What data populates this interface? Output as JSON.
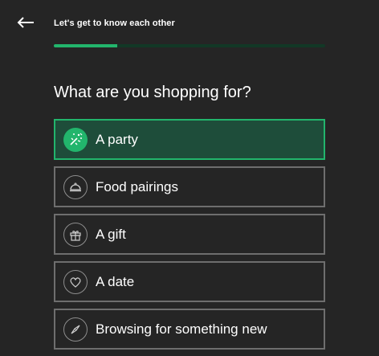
{
  "header": {
    "title": "Let's get to know each other",
    "progress_fraction": 0.235
  },
  "question": "What are you shopping for?",
  "options": [
    {
      "label": "A party",
      "icon": "party-popper-icon",
      "selected": true
    },
    {
      "label": "Food pairings",
      "icon": "cloche-icon",
      "selected": false
    },
    {
      "label": "A gift",
      "icon": "gift-icon",
      "selected": false
    },
    {
      "label": "A date",
      "icon": "heart-icon",
      "selected": false
    },
    {
      "label": "Browsing for something new",
      "icon": "compass-icon",
      "selected": false
    }
  ],
  "colors": {
    "background": "#252525",
    "accent": "#22b56c",
    "selected_fill": "#1e4d3a",
    "border": "#6e6e6e"
  }
}
